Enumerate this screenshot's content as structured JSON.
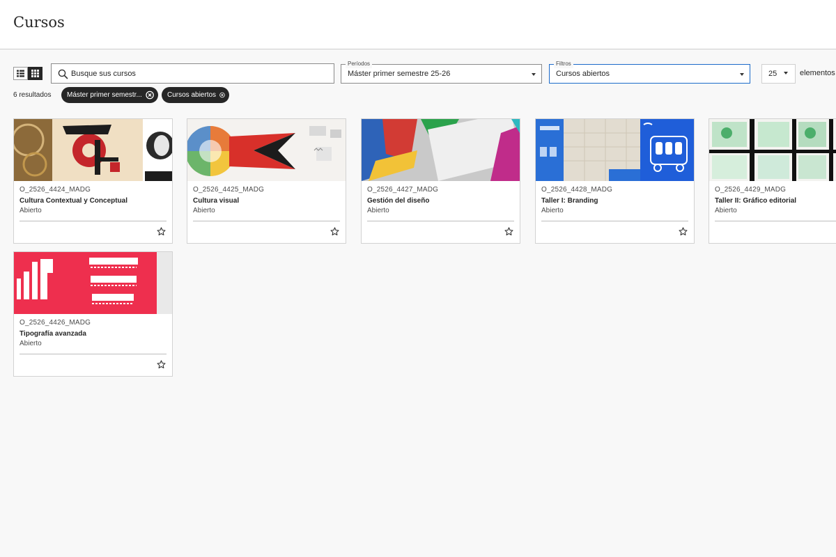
{
  "page": {
    "title": "Cursos",
    "accent_color": "#1b6ac9"
  },
  "toolbar": {
    "list_view_icon": "list-view-icon",
    "grid_view_icon": "grid-view-icon",
    "search": {
      "placeholder": "Busque sus cursos",
      "value": ""
    },
    "periods": {
      "label": "Períodos",
      "selected": "Máster primer semestre 25-26"
    },
    "filters": {
      "label": "Filtros",
      "selected": "Cursos abiertos"
    },
    "per_page": {
      "value": "25",
      "label": "elementos p"
    }
  },
  "results": {
    "count_text": "6 resultados",
    "chips": [
      {
        "label": "Máster primer semestr..."
      },
      {
        "label": "Cursos abiertos"
      }
    ]
  },
  "courses": [
    {
      "code": "O_2526_4424_MADG",
      "name": "Cultura Contextual y Conceptual",
      "status": "Abierto"
    },
    {
      "code": "O_2526_4425_MADG",
      "name": "Cultura visual",
      "status": "Abierto"
    },
    {
      "code": "O_2526_4427_MADG",
      "name": "Gestión del diseño",
      "status": "Abierto"
    },
    {
      "code": "O_2526_4428_MADG",
      "name": "Taller I: Branding",
      "status": "Abierto"
    },
    {
      "code": "O_2526_4429_MADG",
      "name": "Taller II: Gráfico editorial",
      "status": "Abierto"
    },
    {
      "code": "O_2526_4426_MADG",
      "name": "Tipografía avanzada",
      "status": "Abierto"
    }
  ]
}
